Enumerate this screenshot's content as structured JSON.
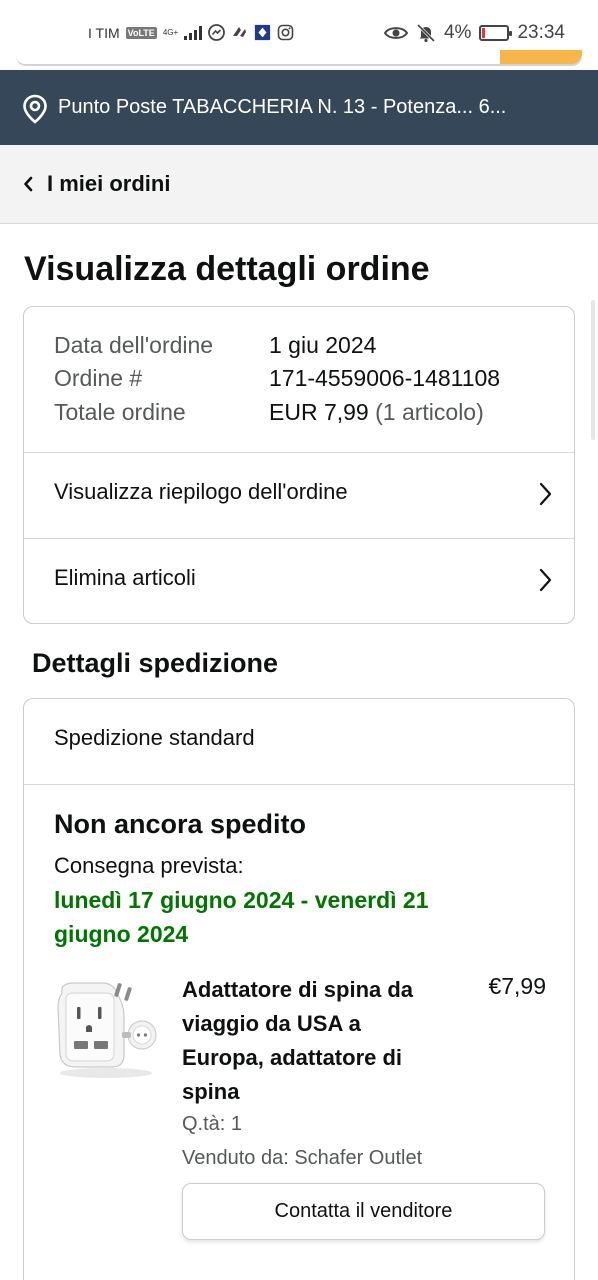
{
  "status_bar": {
    "carrier": "I TIM",
    "volte": "VoLTE",
    "network": "4G+",
    "battery_percent": "4%",
    "time": "23:34"
  },
  "location": {
    "text": "Punto Poste TABACCHERIA N. 13 - Potenza... 6..."
  },
  "breadcrumb": {
    "label": "I miei ordini"
  },
  "page_title": "Visualizza dettagli ordine",
  "order": {
    "date_label": "Data dell'ordine",
    "date_value": "1 giu 2024",
    "number_label": "Ordine #",
    "number_value": "171-4559006-1481108",
    "total_label": "Totale ordine",
    "total_value": "EUR 7,99",
    "total_items": "(1 articolo)"
  },
  "links": {
    "summary": "Visualizza riepilogo dell'ordine",
    "delete_items": "Elimina articoli"
  },
  "shipping": {
    "section_title": "Dettagli spedizione",
    "type": "Spedizione standard",
    "status": "Non ancora spedito",
    "expected_label": "Consegna prevista:",
    "expected_dates": "lunedì 17 giugno 2024 - venerdì 21 giugno 2024"
  },
  "product": {
    "title": "Adattatore di spina da viaggio da USA a Europa, adattatore di spina",
    "price": "€7,99",
    "quantity": "Q.tà: 1",
    "seller": "Venduto da: Schafer Outlet",
    "contact_button": "Contatta il venditore"
  },
  "colors": {
    "location_bar": "#37475a",
    "delivery_green": "#007600",
    "search_button": "#f7b54a"
  }
}
